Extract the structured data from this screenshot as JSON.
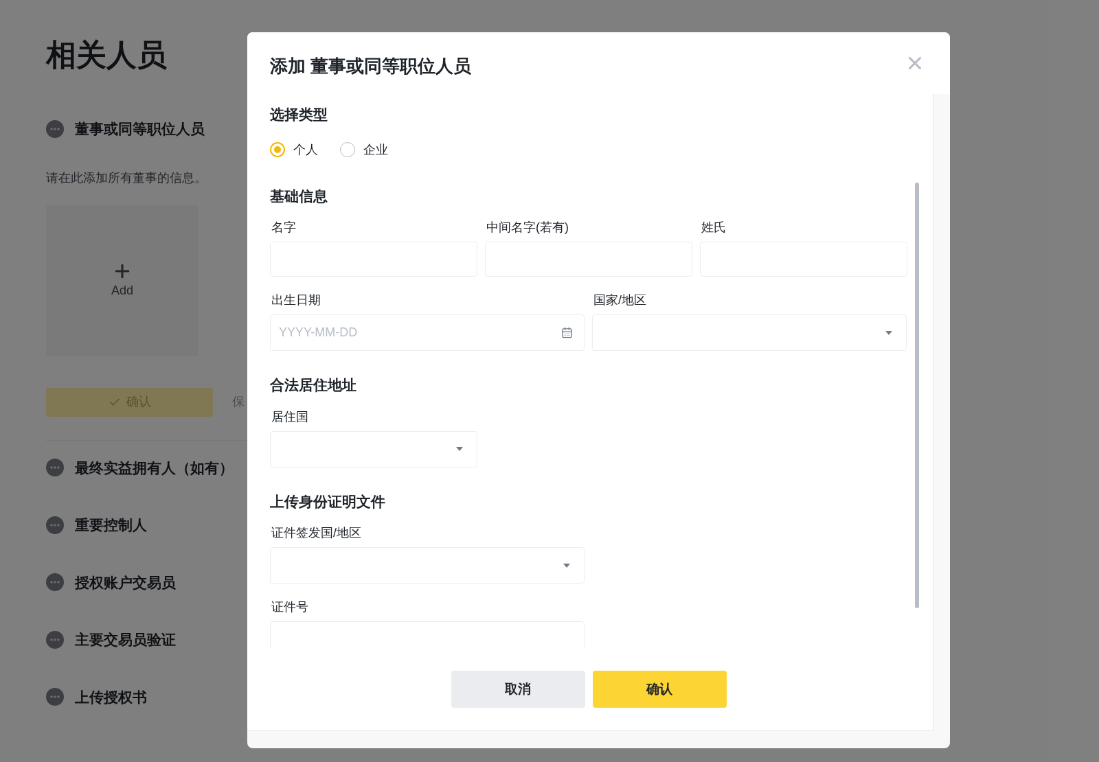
{
  "page": {
    "title": "相关人员",
    "current_section": {
      "label": "董事或同等职位人员",
      "description": "请在此添加所有董事的信息。",
      "add_label": "Add",
      "confirm_label": "确认",
      "save_label": "保"
    },
    "other_sections": [
      {
        "label": "最终实益拥有人（如有）"
      },
      {
        "label": "重要控制人"
      },
      {
        "label": "授权账户交易员"
      },
      {
        "label": "主要交易员验证"
      },
      {
        "label": "上传授权书"
      }
    ]
  },
  "dialog": {
    "title": "添加 董事或同等职位人员",
    "type_heading": "选择类型",
    "type_options": [
      {
        "label": "个人",
        "selected": true
      },
      {
        "label": "企业",
        "selected": false
      }
    ],
    "groups": [
      {
        "heading": "基础信息",
        "rows": [
          [
            {
              "label": "名字",
              "kind": "text"
            },
            {
              "label": "中间名字(若有)",
              "kind": "text"
            },
            {
              "label": "姓氏",
              "kind": "text"
            }
          ],
          [
            {
              "label": "出生日期",
              "kind": "date",
              "placeholder": "YYYY-MM-DD"
            },
            {
              "label": "国家/地区",
              "kind": "select"
            }
          ]
        ]
      },
      {
        "heading": "合法居住地址",
        "rows": [
          [
            {
              "label": "居住国",
              "kind": "select"
            }
          ]
        ]
      },
      {
        "heading": "上传身份证明文件",
        "rows": [
          [
            {
              "label": "证件签发国/地区",
              "kind": "select"
            }
          ],
          [
            {
              "label": "证件号",
              "kind": "text"
            }
          ]
        ]
      }
    ],
    "cancel_label": "取消",
    "confirm_label": "确认"
  }
}
